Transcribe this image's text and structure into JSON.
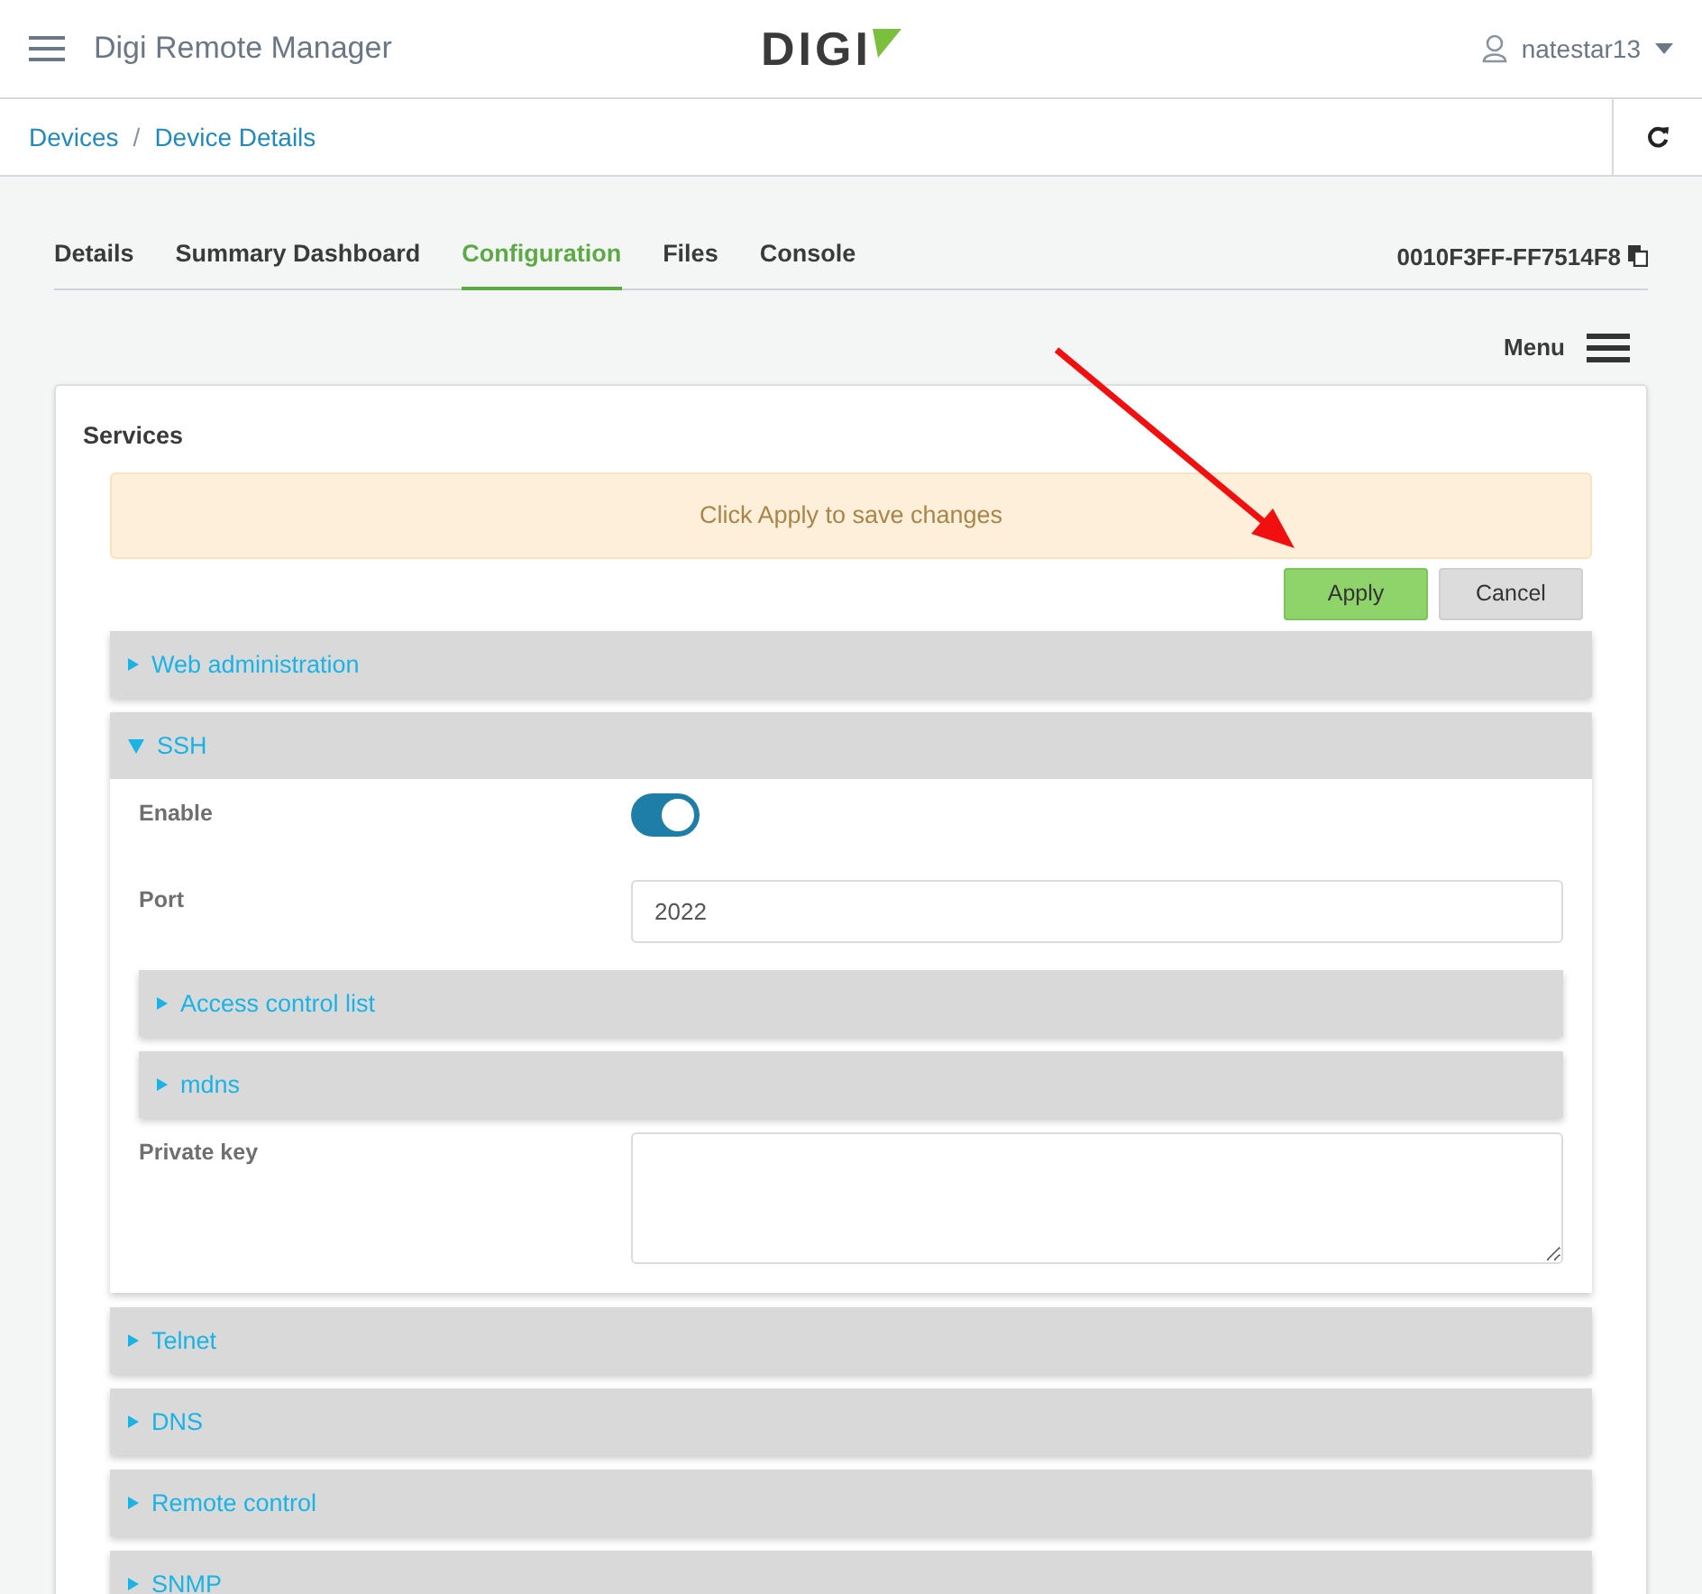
{
  "header": {
    "app_title": "Digi Remote Manager",
    "logo": "DIGI",
    "user": "natestar13"
  },
  "breadcrumb": [
    "Devices",
    "Device Details"
  ],
  "breadcrumb_separator": "/",
  "tabs": [
    {
      "label": "Details",
      "selected": false
    },
    {
      "label": "Summary Dashboard",
      "selected": false
    },
    {
      "label": "Configuration",
      "selected": true
    },
    {
      "label": "Files",
      "selected": false
    },
    {
      "label": "Console",
      "selected": false
    }
  ],
  "device_id": "0010F3FF-FF7514F8",
  "menu_label": "Menu",
  "panel": {
    "title": "Services",
    "notice": "Click Apply to save changes",
    "buttons": [
      {
        "label": "Apply",
        "kind": "primary"
      },
      {
        "label": "Cancel",
        "kind": "secondary"
      }
    ],
    "sections": [
      {
        "label": "Web administration",
        "expanded": false
      },
      {
        "label": "SSH",
        "expanded": true,
        "fields": [
          {
            "kind": "toggle",
            "label": "Enable",
            "on": true
          },
          {
            "kind": "text",
            "label": "Port",
            "value": "2022"
          },
          {
            "kind": "group",
            "label": "Access control list",
            "expanded": false
          },
          {
            "kind": "group",
            "label": "mdns",
            "expanded": false
          },
          {
            "kind": "textarea",
            "label": "Private key"
          }
        ]
      },
      {
        "label": "Telnet",
        "expanded": false
      },
      {
        "label": "DNS",
        "expanded": false
      },
      {
        "label": "Remote control",
        "expanded": false
      },
      {
        "label": "SNMP",
        "expanded": false
      }
    ]
  }
}
